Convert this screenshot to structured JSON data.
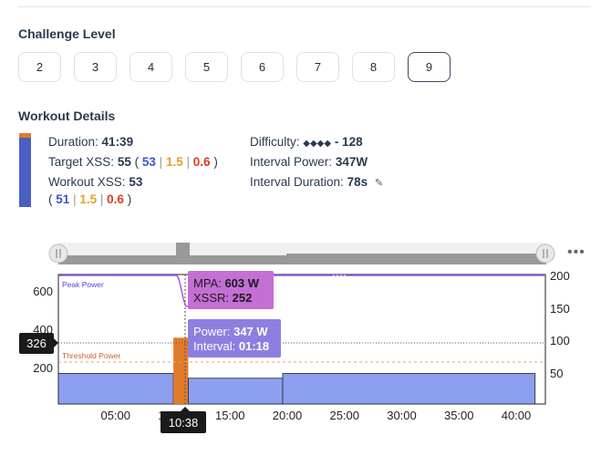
{
  "challenge": {
    "title": "Challenge Level",
    "levels": [
      "2",
      "3",
      "4",
      "5",
      "6",
      "7",
      "8",
      "9"
    ],
    "selected": "9"
  },
  "workout": {
    "title": "Workout Details",
    "duration_label": "Duration:",
    "duration_value": "41:39",
    "target_label": "Target XSS:",
    "target_value": "55",
    "target_blue": "53",
    "target_orange": "1.5",
    "target_red": "0.6",
    "workout_label": "Workout XSS:",
    "workout_value": "53",
    "workout_blue": "51",
    "workout_orange": "1.5",
    "workout_red": "0.6",
    "difficulty_label": "Difficulty:",
    "difficulty_diamonds": "◆◆◆◆",
    "difficulty_value": "- 128",
    "interval_power_label": "Interval Power:",
    "interval_power_value": "347W",
    "interval_duration_label": "Interval Duration:",
    "interval_duration_value": "78s",
    "edit_icon": "pencil-square-icon"
  },
  "chart": {
    "left_ticks": [
      "600",
      "400",
      "200"
    ],
    "right_ticks": [
      "200",
      "150",
      "100",
      "50"
    ],
    "x_ticks": [
      "05:00",
      "10:00",
      "15:00",
      "20:00",
      "25:00",
      "30:00",
      "35:00",
      "40:00"
    ],
    "peak_power_label": "Peak Power",
    "threshold_power_label": "Threshold Power",
    "y_readout": "326",
    "x_readout": "10:38",
    "tooltip_mpa_label": "MPA:",
    "tooltip_mpa_value": "603 W",
    "tooltip_xssr_label": "XSSR:",
    "tooltip_xssr_value": "252",
    "tooltip_power_label": "Power:",
    "tooltip_power_value": "347 W",
    "tooltip_interval_label": "Interval:",
    "tooltip_interval_value": "01:18",
    "colors": {
      "blue_fill": "#8c9ff0",
      "orange_interval": "#e07b2a",
      "purple_line": "#a855f7",
      "tooltip_mpa": "#c46fd4",
      "tooltip_power": "#8d7fe0"
    }
  },
  "chart_data": {
    "type": "area",
    "x_unit": "minutes",
    "workout_power_segments": [
      {
        "start": 0,
        "end": 10.05,
        "watts": 160
      },
      {
        "start": 10.05,
        "end": 11.35,
        "watts": 347
      },
      {
        "start": 11.35,
        "end": 19.6,
        "watts": 135
      },
      {
        "start": 19.6,
        "end": 41.65,
        "watts": 160
      }
    ],
    "peak_power_watts": 603,
    "threshold_power_watts": 248,
    "left_ylim": [
      0,
      650
    ],
    "right_ylim": [
      0,
      200
    ]
  }
}
